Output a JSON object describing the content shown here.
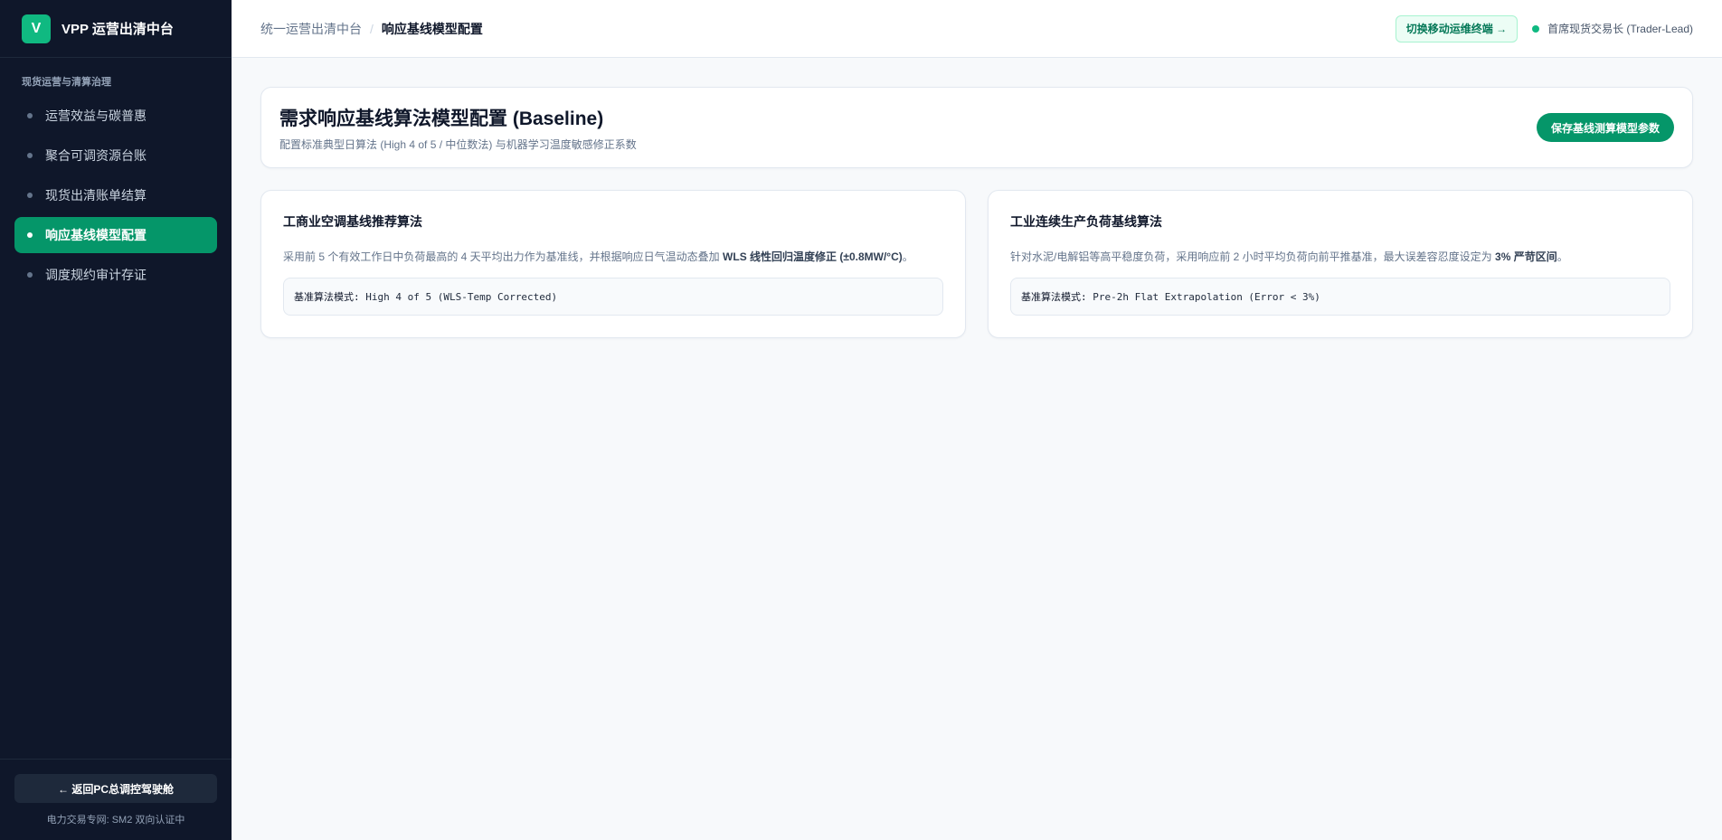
{
  "sidebar": {
    "logo_letter": "V",
    "brand": "VPP 运营出清中台",
    "section_label": "现货运营与清算治理",
    "items": [
      {
        "label": "运营效益与碳普惠",
        "active": false
      },
      {
        "label": "聚合可调资源台账",
        "active": false
      },
      {
        "label": "现货出清账单结算",
        "active": false
      },
      {
        "label": "响应基线模型配置",
        "active": true
      },
      {
        "label": "调度规约审计存证",
        "active": false
      }
    ],
    "back_button": "← 返回PC总调控驾驶舱",
    "footer_note": "电力交易专网: SM2 双向认证中"
  },
  "topbar": {
    "breadcrumb_parent": "统一运营出清中台",
    "breadcrumb_sep": "/",
    "breadcrumb_current": "响应基线模型配置",
    "switch_button": "切换移动运维终端 →",
    "user": "首席现货交易长 (Trader-Lead)"
  },
  "header": {
    "title": "需求响应基线算法模型配置 (Baseline)",
    "subtitle": "配置标准典型日算法 (High 4 of 5 / 中位数法) 与机器学习温度敏感修正系数",
    "save_button": "保存基线测算模型参数"
  },
  "cards": [
    {
      "title": "工商业空调基线推荐算法",
      "desc_prefix": "采用前 5 个有效工作日中负荷最高的 4 天平均出力作为基准线，并根据响应日气温动态叠加 ",
      "desc_bold": "WLS 线性回归温度修正 (±0.8MW/°C)",
      "desc_suffix": "。",
      "formula_label": "基准算法模式:",
      "formula_value": "High 4 of 5 (WLS-Temp Corrected)"
    },
    {
      "title": "工业连续生产负荷基线算法",
      "desc_prefix": "针对水泥/电解铝等高平稳度负荷，采用响应前 2 小时平均负荷向前平推基准，最大误差容忍度设定为 ",
      "desc_bold": "3% 严苛区间",
      "desc_suffix": "。",
      "formula_label": "基准算法模式:",
      "formula_value": "Pre-2h Flat Extrapolation (Error < 3%)"
    }
  ],
  "colors": {
    "sidebar_bg": "#0f172a",
    "accent": "#059669",
    "brand_logo": "#10b981",
    "page_bg": "#f7f9fb"
  }
}
